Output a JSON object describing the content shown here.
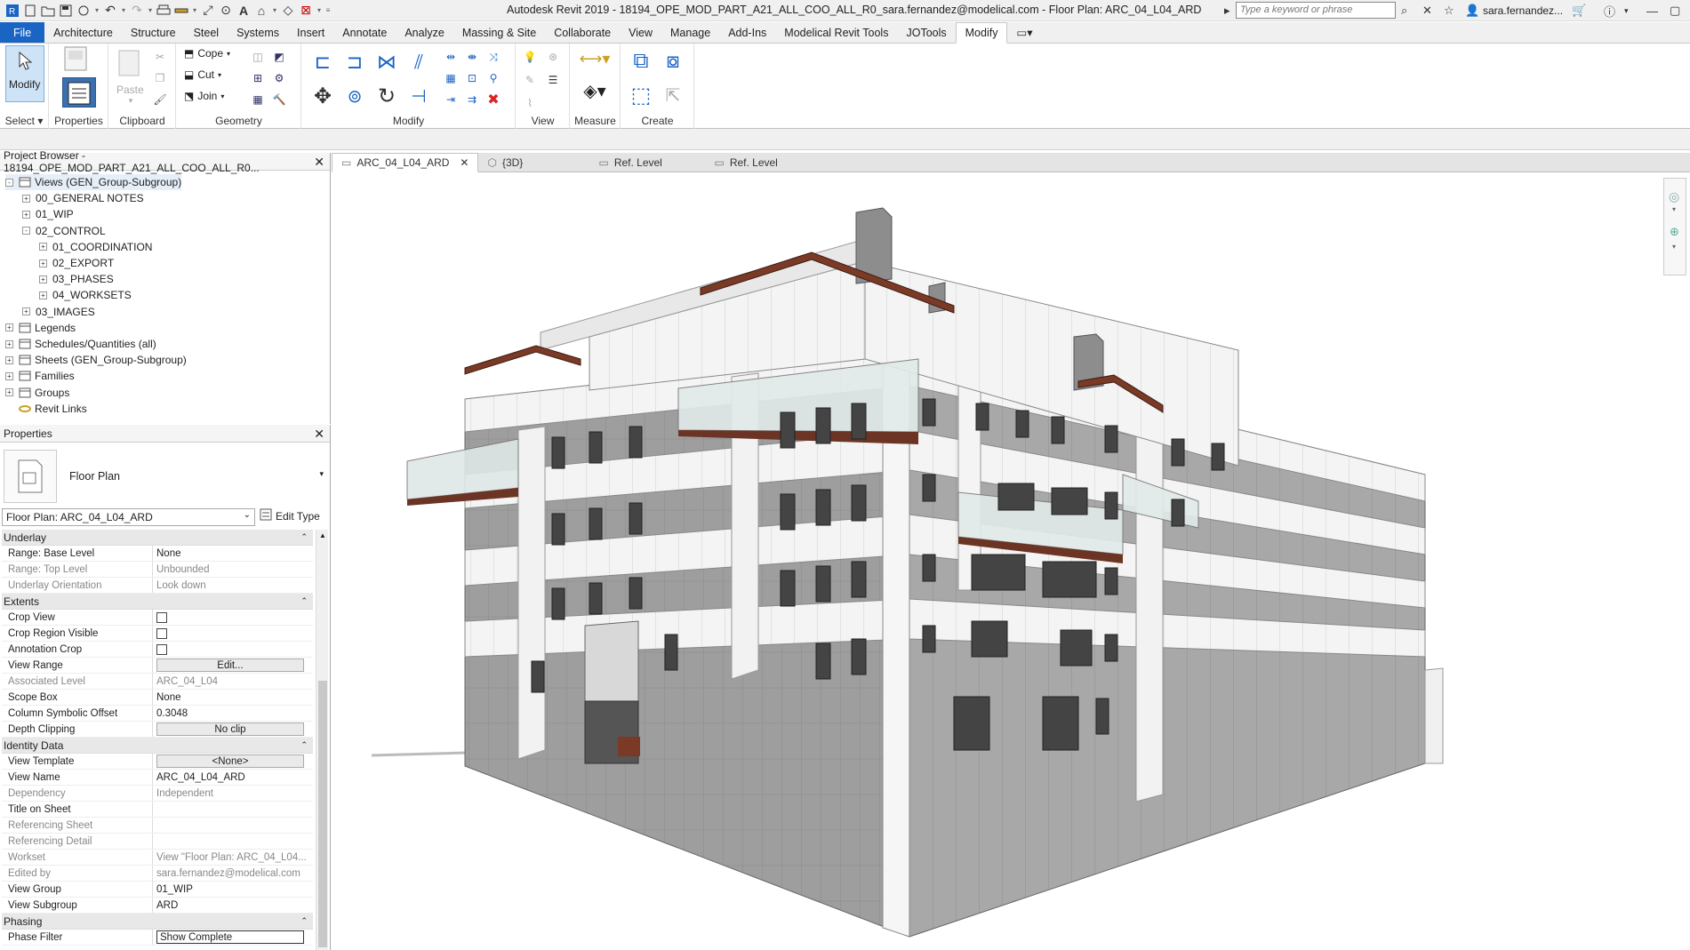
{
  "titlebar": {
    "title": "Autodesk Revit 2019 - 18194_OPE_MOD_PART_A21_ALL_COO_ALL_R0_sara.fernandez@modelical.com - Floor Plan: ARC_04_L04_ARD",
    "search_placeholder": "Type a keyword or phrase",
    "user": "sara.fernandez..."
  },
  "tabs": [
    "File",
    "Architecture",
    "Structure",
    "Steel",
    "Systems",
    "Insert",
    "Annotate",
    "Analyze",
    "Massing & Site",
    "Collaborate",
    "View",
    "Manage",
    "Add-Ins",
    "Modelical Revit Tools",
    "JOTools",
    "Modify"
  ],
  "ribbon": {
    "select": {
      "modify_label": "Modify",
      "panel_label": "Select"
    },
    "properties": {
      "label": "Properties"
    },
    "clipboard": {
      "paste_label": "Paste",
      "panel_label": "Clipboard"
    },
    "geometry": {
      "cope_label": "Cope",
      "cut_label": "Cut",
      "join_label": "Join",
      "panel_label": "Geometry"
    },
    "modify_panel_label": "Modify",
    "view_panel_label": "View",
    "measure_panel_label": "Measure",
    "create_panel_label": "Create"
  },
  "project_browser": {
    "title": "Project Browser - 18194_OPE_MOD_PART_A21_ALL_COO_ALL_R0...",
    "items": [
      {
        "label": "Views (GEN_Group-Subgroup)",
        "toggle": "-",
        "level": 0
      },
      {
        "label": "00_GENERAL NOTES",
        "toggle": "+",
        "level": 1
      },
      {
        "label": "01_WIP",
        "toggle": "+",
        "level": 1
      },
      {
        "label": "02_CONTROL",
        "toggle": "-",
        "level": 1
      },
      {
        "label": "01_COORDINATION",
        "toggle": "+",
        "level": 2
      },
      {
        "label": "02_EXPORT",
        "toggle": "+",
        "level": 2
      },
      {
        "label": "03_PHASES",
        "toggle": "+",
        "level": 2
      },
      {
        "label": "04_WORKSETS",
        "toggle": "+",
        "level": 2
      },
      {
        "label": "03_IMAGES",
        "toggle": "+",
        "level": 1
      },
      {
        "label": "Legends",
        "toggle": "+",
        "level": 0
      },
      {
        "label": "Schedules/Quantities (all)",
        "toggle": "+",
        "level": 0
      },
      {
        "label": "Sheets (GEN_Group-Subgroup)",
        "toggle": "+",
        "level": 0
      },
      {
        "label": "Families",
        "toggle": "+",
        "level": 0
      },
      {
        "label": "Groups",
        "toggle": "+",
        "level": 0
      },
      {
        "label": "Revit Links",
        "toggle": "",
        "level": 0
      }
    ]
  },
  "properties": {
    "title": "Properties",
    "type_name": "Floor Plan",
    "instance_selector": "Floor Plan: ARC_04_L04_ARD",
    "edit_type_label": "Edit Type",
    "sections": [
      {
        "name": "Underlay",
        "rows": [
          {
            "k": "Range: Base Level",
            "v": "None",
            "kind": "text",
            "dis": false
          },
          {
            "k": "Range: Top Level",
            "v": "Unbounded",
            "kind": "text",
            "dis": true
          },
          {
            "k": "Underlay Orientation",
            "v": "Look down",
            "kind": "text",
            "dis": true
          }
        ]
      },
      {
        "name": "Extents",
        "rows": [
          {
            "k": "Crop View",
            "v": "",
            "kind": "check",
            "dis": false
          },
          {
            "k": "Crop Region Visible",
            "v": "",
            "kind": "check",
            "dis": false
          },
          {
            "k": "Annotation Crop",
            "v": "",
            "kind": "check",
            "dis": false
          },
          {
            "k": "View Range",
            "v": "Edit...",
            "kind": "button",
            "dis": false
          },
          {
            "k": "Associated Level",
            "v": "ARC_04_L04",
            "kind": "text",
            "dis": true
          },
          {
            "k": "Scope Box",
            "v": "None",
            "kind": "text",
            "dis": false
          },
          {
            "k": "Column Symbolic Offset",
            "v": "0.3048",
            "kind": "text",
            "dis": false
          },
          {
            "k": "Depth Clipping",
            "v": "No clip",
            "kind": "button",
            "dis": false
          }
        ]
      },
      {
        "name": "Identity Data",
        "rows": [
          {
            "k": "View Template",
            "v": "<None>",
            "kind": "button",
            "dis": false
          },
          {
            "k": "View Name",
            "v": "ARC_04_L04_ARD",
            "kind": "text",
            "dis": false
          },
          {
            "k": "Dependency",
            "v": "Independent",
            "kind": "text",
            "dis": true
          },
          {
            "k": "Title on Sheet",
            "v": "",
            "kind": "text",
            "dis": false
          },
          {
            "k": "Referencing Sheet",
            "v": "",
            "kind": "text",
            "dis": true
          },
          {
            "k": "Referencing Detail",
            "v": "",
            "kind": "text",
            "dis": true
          },
          {
            "k": "Workset",
            "v": "View \"Floor Plan: ARC_04_L04...",
            "kind": "text",
            "dis": true
          },
          {
            "k": "Edited by",
            "v": "sara.fernandez@modelical.com",
            "kind": "text",
            "dis": true
          },
          {
            "k": "View Group",
            "v": "01_WIP",
            "kind": "text",
            "dis": false
          },
          {
            "k": "View Subgroup",
            "v": "ARD",
            "kind": "text",
            "dis": false
          }
        ]
      },
      {
        "name": "Phasing",
        "rows": [
          {
            "k": "Phase Filter",
            "v": "Show Complete",
            "kind": "field",
            "dis": false
          }
        ]
      }
    ]
  },
  "view_tabs": [
    {
      "label": "ARC_04_L04_ARD",
      "active": true,
      "closable": true
    },
    {
      "label": "{3D}",
      "active": false,
      "closable": false
    },
    {
      "label": "Ref. Level",
      "active": false,
      "closable": false
    },
    {
      "label": "Ref. Level",
      "active": false,
      "closable": false
    }
  ],
  "colors": {
    "file_tab": "#1a64c4",
    "wood": "#7a3a26",
    "facade_grey": "#9a9a9a"
  }
}
